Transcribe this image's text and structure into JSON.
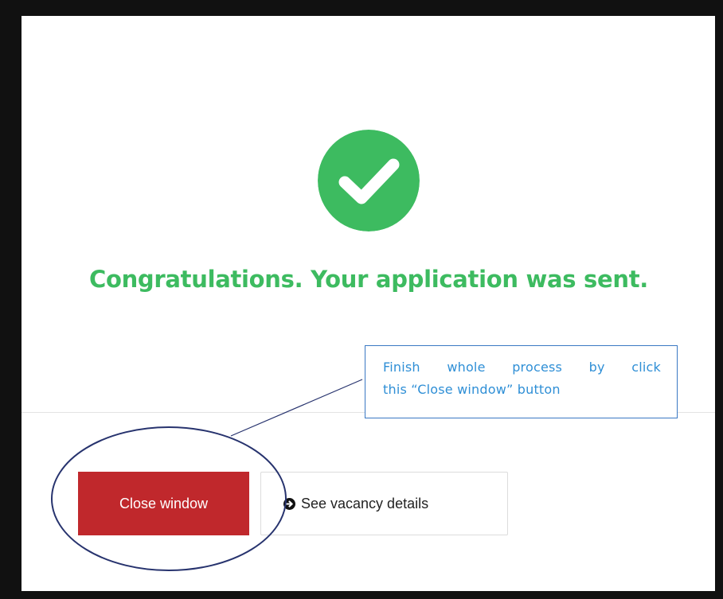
{
  "dialog": {
    "message": "Congratulations. Your application was sent.",
    "success_icon": "check-circle-icon",
    "colors": {
      "success": "#3dbb60",
      "primary_button": "#c0282c"
    }
  },
  "actions": {
    "close_label": "Close window",
    "details_label": "See vacancy details",
    "details_icon": "arrow-circle-right-icon"
  },
  "annotation": {
    "line1": "Finish whole process by click",
    "line2": "this “Close window” button",
    "color": "#2f8fd6",
    "border_color": "#3a78c3",
    "ellipse_color": "#27336e"
  }
}
